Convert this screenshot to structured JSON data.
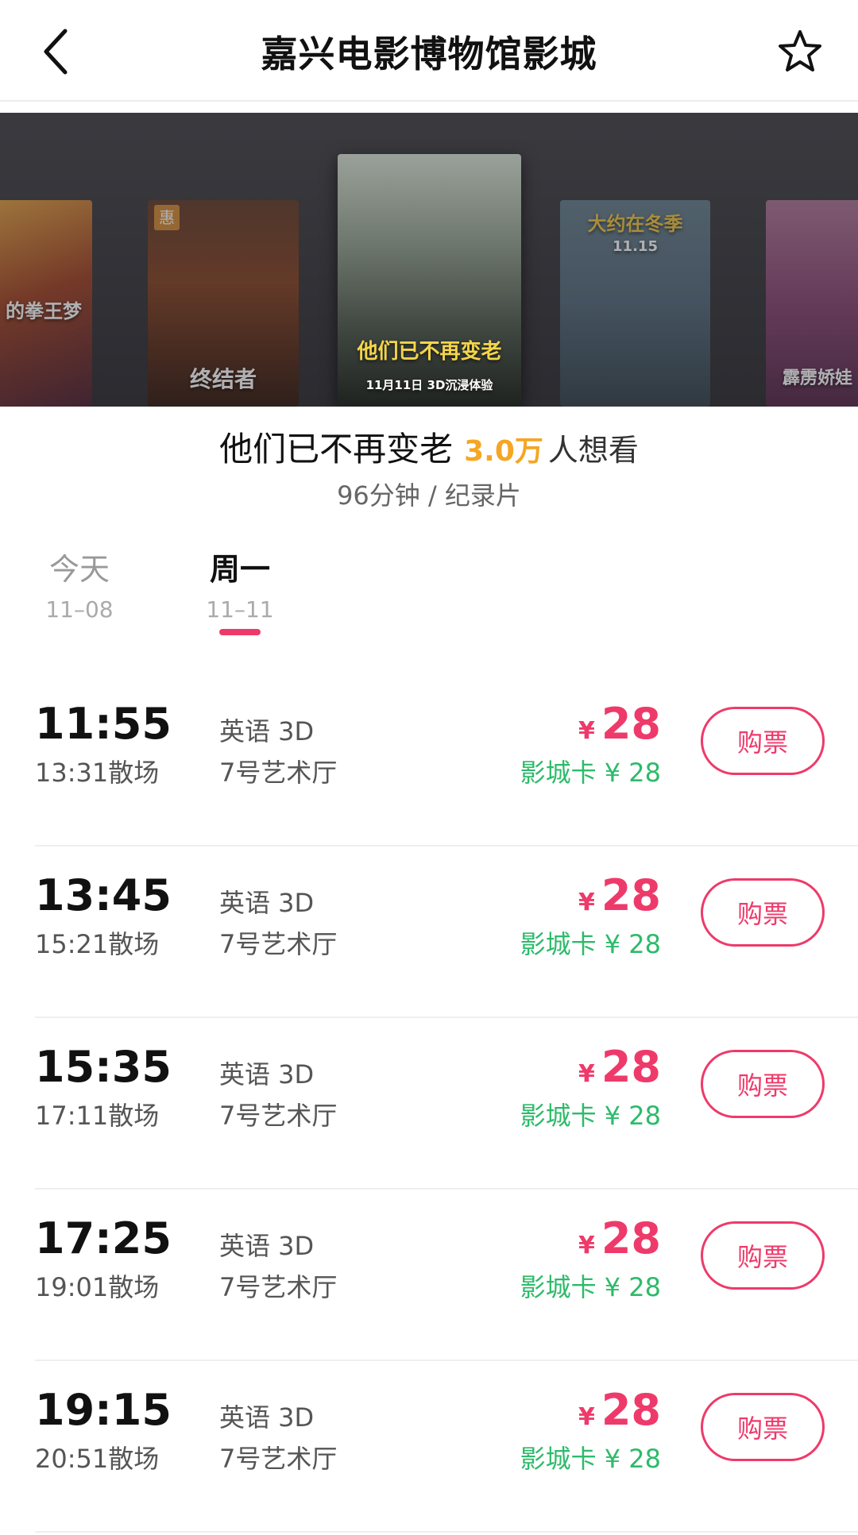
{
  "header": {
    "title": "嘉兴电影博物馆影城"
  },
  "carousel": {
    "posters": [
      {
        "title": "的拳王梦"
      },
      {
        "title": "终结者",
        "badge": "惠"
      },
      {
        "title": "他们已不再变老",
        "caption": "11月11日 3D沉浸体验"
      },
      {
        "title": "大约在冬季",
        "caption": "11.15"
      },
      {
        "title": "霹雳娇娃"
      }
    ]
  },
  "movie": {
    "name": "他们已不再变老",
    "score": "3.0万",
    "want": "人想看",
    "meta": "96分钟 / 纪录片"
  },
  "dates": [
    {
      "day": "今天",
      "date": "11–08"
    },
    {
      "day": "周一",
      "date": "11–11"
    }
  ],
  "showtimes": [
    {
      "start": "11:55",
      "end": "13:31散场",
      "lang": "英语 3D",
      "hall": "7号艺术厅",
      "yen": "¥",
      "price": "28",
      "card": "影城卡 ¥ 28",
      "buy": "购票"
    },
    {
      "start": "13:45",
      "end": "15:21散场",
      "lang": "英语 3D",
      "hall": "7号艺术厅",
      "yen": "¥",
      "price": "28",
      "card": "影城卡 ¥ 28",
      "buy": "购票"
    },
    {
      "start": "15:35",
      "end": "17:11散场",
      "lang": "英语 3D",
      "hall": "7号艺术厅",
      "yen": "¥",
      "price": "28",
      "card": "影城卡 ¥ 28",
      "buy": "购票"
    },
    {
      "start": "17:25",
      "end": "19:01散场",
      "lang": "英语 3D",
      "hall": "7号艺术厅",
      "yen": "¥",
      "price": "28",
      "card": "影城卡 ¥ 28",
      "buy": "购票"
    },
    {
      "start": "19:15",
      "end": "20:51散场",
      "lang": "英语 3D",
      "hall": "7号艺术厅",
      "yen": "¥",
      "price": "28",
      "card": "影城卡 ¥ 28",
      "buy": "购票"
    }
  ],
  "colors": {
    "accent": "#ee3a6a",
    "score": "#f5a623",
    "card_price": "#2dbb6a"
  }
}
